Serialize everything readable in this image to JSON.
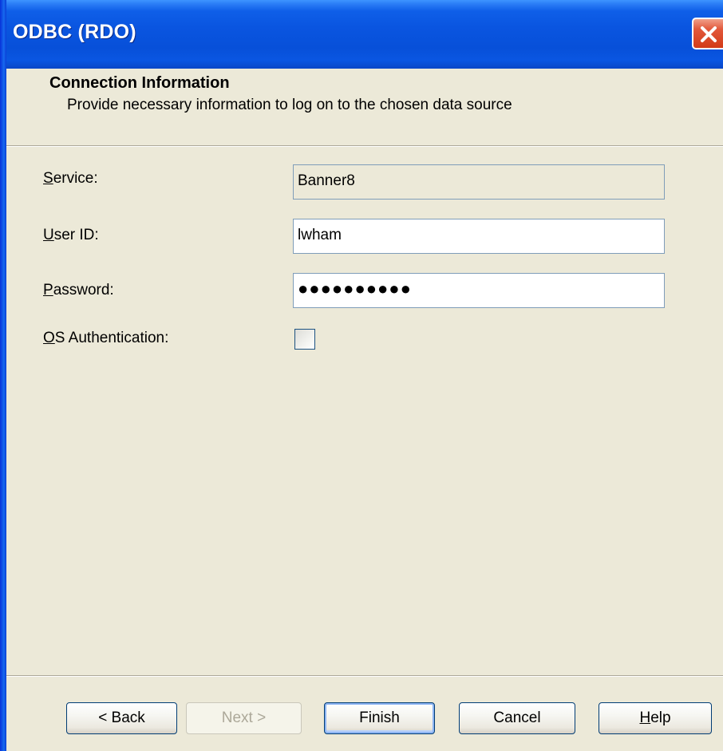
{
  "window": {
    "title": "ODBC (RDO)"
  },
  "header": {
    "title": "Connection Information",
    "subtitle": "Provide necessary information to log on to the chosen data source"
  },
  "form": {
    "service": {
      "label_accel": "S",
      "label_rest": "ervice:",
      "value": "Banner8"
    },
    "user_id": {
      "label_accel": "U",
      "label_rest": "ser ID:",
      "value": "lwham"
    },
    "password": {
      "label_accel": "P",
      "label_rest": "assword:",
      "value": "●●●●●●●●●●"
    },
    "os_auth": {
      "label_accel": "O",
      "label_rest": "S Authentication:",
      "checked": false
    }
  },
  "buttons": {
    "back": "< Back",
    "next": "Next >",
    "finish": "Finish",
    "cancel": "Cancel",
    "help_accel": "H",
    "help_rest": "elp"
  },
  "icons": {
    "close": "close-icon"
  },
  "colors": {
    "titlebar": "#0a55e0",
    "dialog_bg": "#ece9d8",
    "close_button": "#d23b18"
  }
}
